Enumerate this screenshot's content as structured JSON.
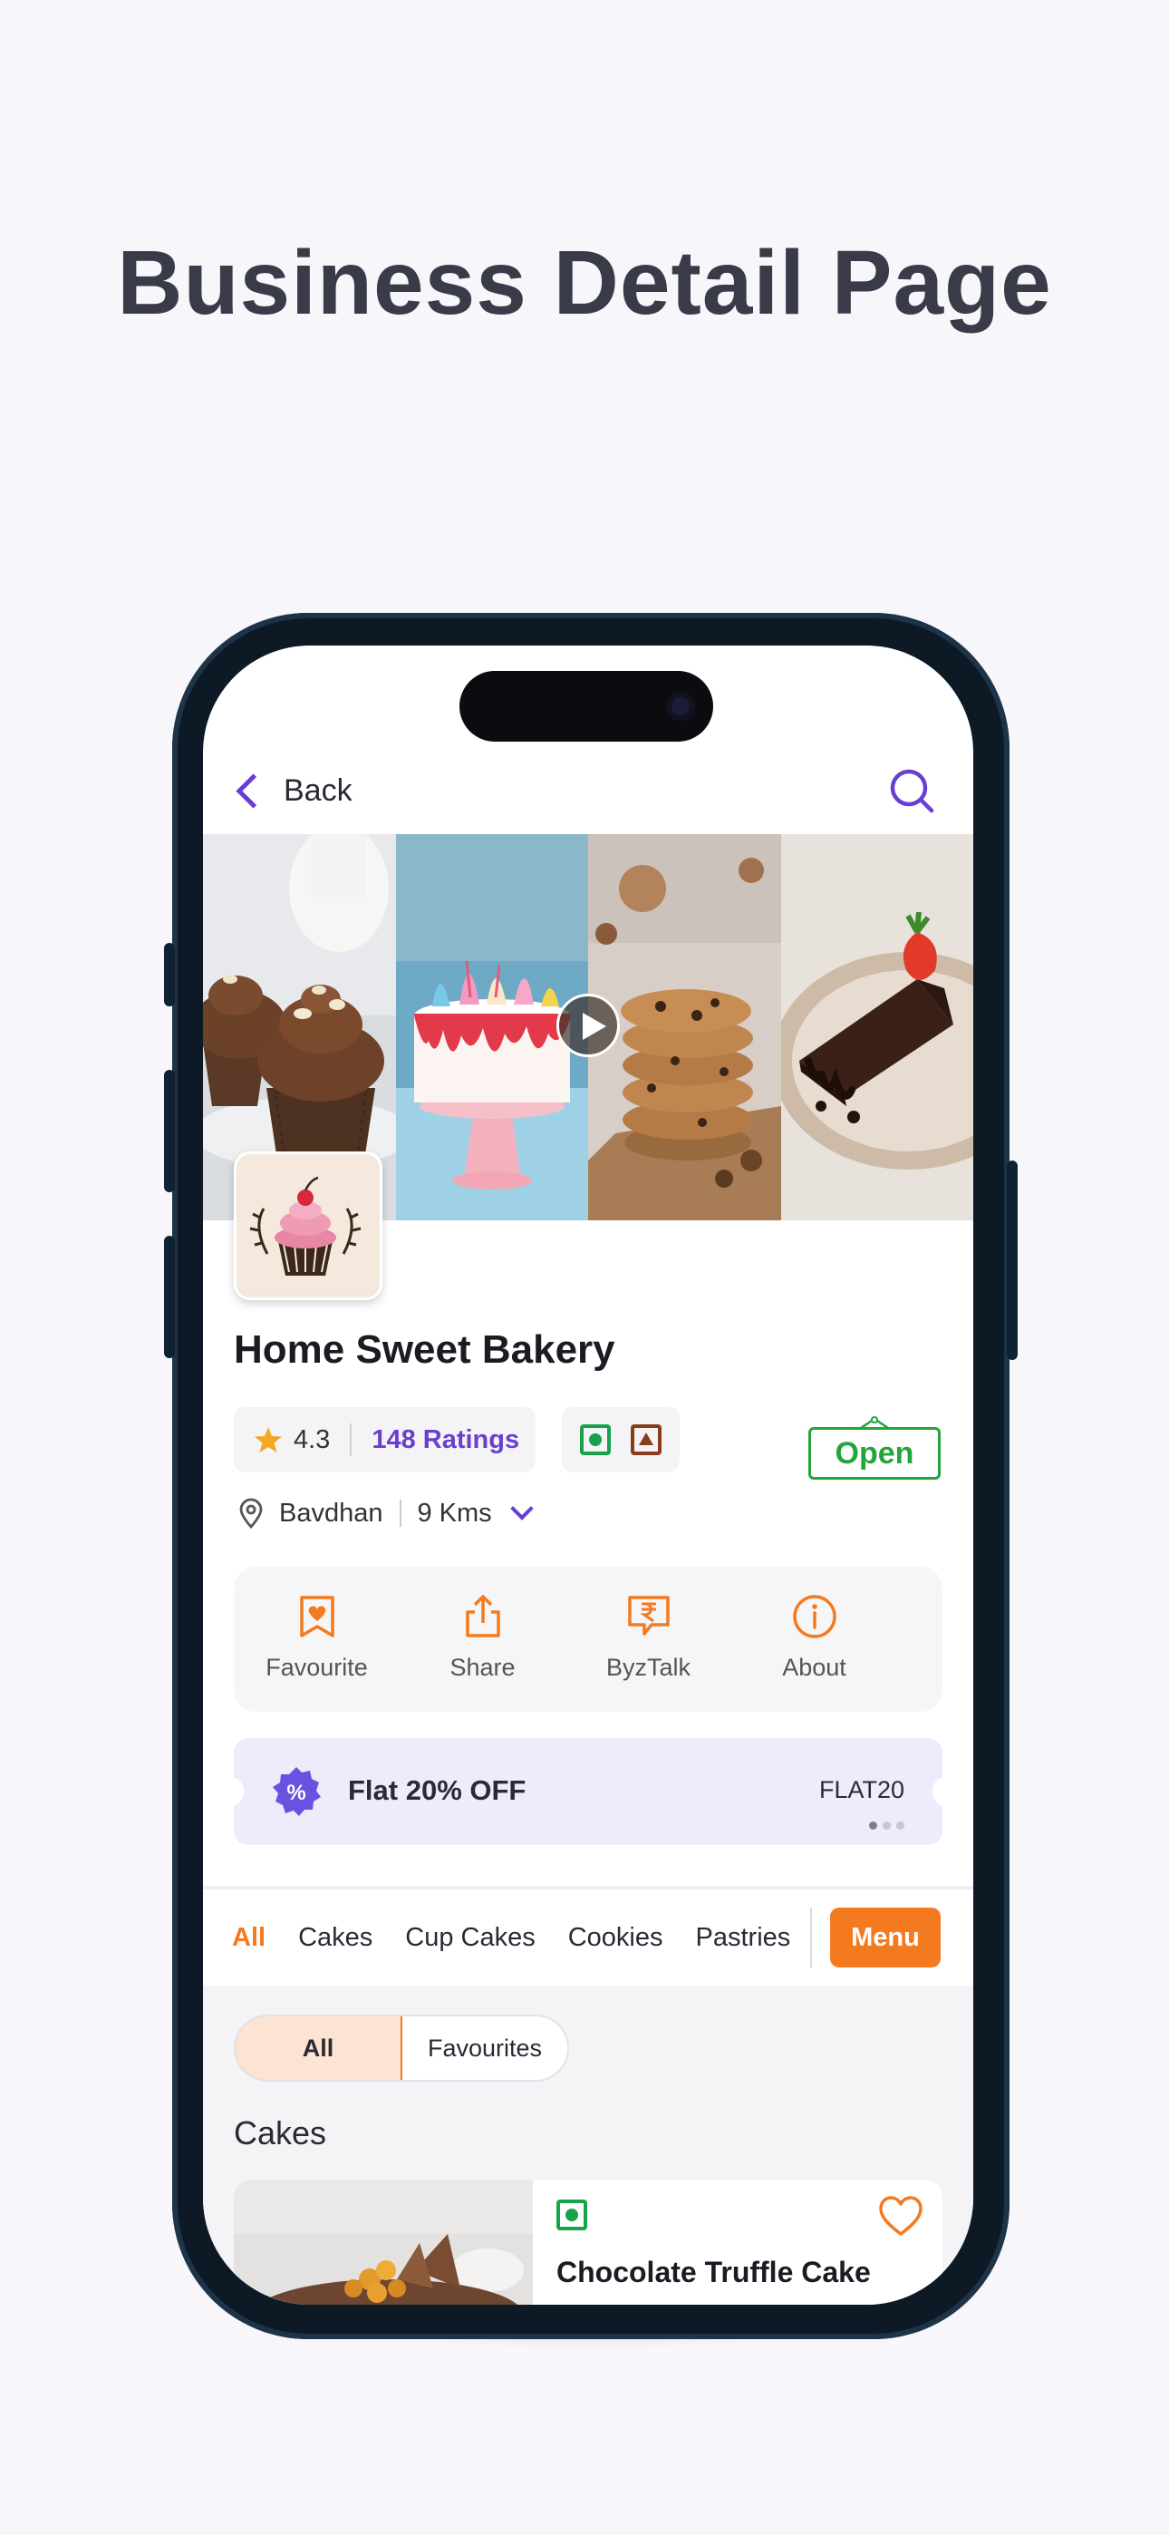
{
  "headline": "Business Detail Page",
  "topbar": {
    "back_label": "Back",
    "search_icon": "search-icon"
  },
  "gallery": {
    "images": [
      "cupcakes-photo",
      "drip-cake-photo",
      "cookies-photo",
      "chocolate-cake-slice-photo"
    ],
    "play_icon": "play-icon"
  },
  "business": {
    "name": "Home Sweet Bakery",
    "rating": "4.3",
    "ratings_count": "148 Ratings",
    "status": "Open",
    "location": "Bavdhan",
    "distance": "9 Kms"
  },
  "actions": [
    {
      "label": "Favourite",
      "icon": "bookmark-heart-icon"
    },
    {
      "label": "Share",
      "icon": "share-icon"
    },
    {
      "label": "ByzTalk",
      "icon": "rupee-chat-icon"
    },
    {
      "label": "About",
      "icon": "info-icon"
    }
  ],
  "offer": {
    "title": "Flat 20% OFF",
    "code": "FLAT20",
    "badge": "%"
  },
  "categories": {
    "items": [
      "All",
      "Cakes",
      "Cup Cakes",
      "Cookies",
      "Pastries"
    ],
    "active": "All",
    "menu_label": "Menu"
  },
  "filter": {
    "options": [
      "All",
      "Favourites"
    ],
    "active": "All"
  },
  "section": {
    "title": "Cakes"
  },
  "product": {
    "title": "Chocolate Truffle Cake"
  },
  "colors": {
    "accent": "#f47a1f",
    "brand": "#6a3fd0",
    "veg": "#16a34a",
    "open": "#22a63a"
  }
}
